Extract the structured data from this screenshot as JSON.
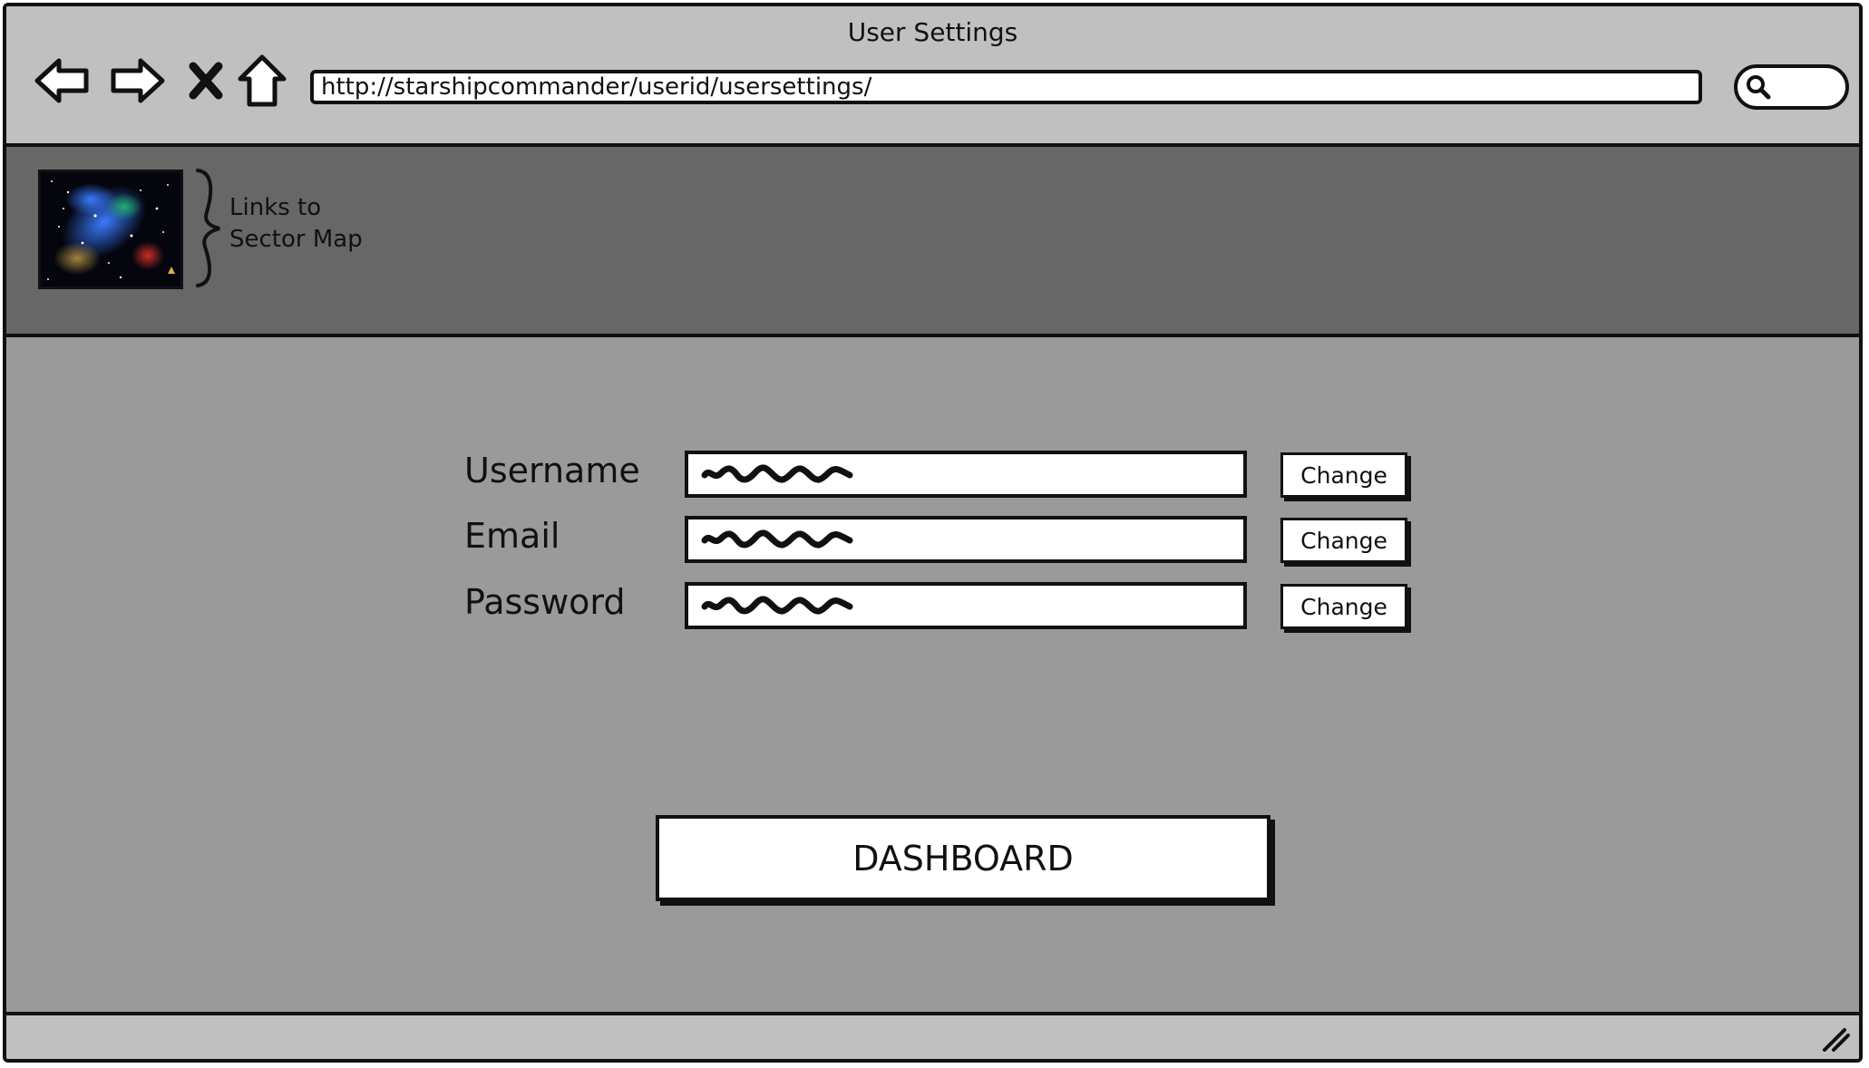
{
  "window": {
    "title": "User Settings"
  },
  "browser": {
    "url": "http://starshipcommander/userid/usersettings/",
    "nav_icons": [
      "back-arrow-icon",
      "forward-arrow-icon",
      "close-x-icon",
      "home-icon"
    ],
    "search_icon": "search-icon"
  },
  "header": {
    "thumbnail": "galaxy-sector-map-image",
    "note_line1": "Links to",
    "note_line2": "Sector Map"
  },
  "form": {
    "fields": [
      {
        "label": "Username",
        "button": "Change"
      },
      {
        "label": "Email",
        "button": "Change"
      },
      {
        "label": "Password",
        "button": "Change"
      }
    ]
  },
  "dashboard_button": "DASHBOARD",
  "colors": {
    "chrome": "#c0c0c0",
    "header_bg": "#676767",
    "content_bg": "#9a9a9a",
    "outline": "#111111"
  }
}
